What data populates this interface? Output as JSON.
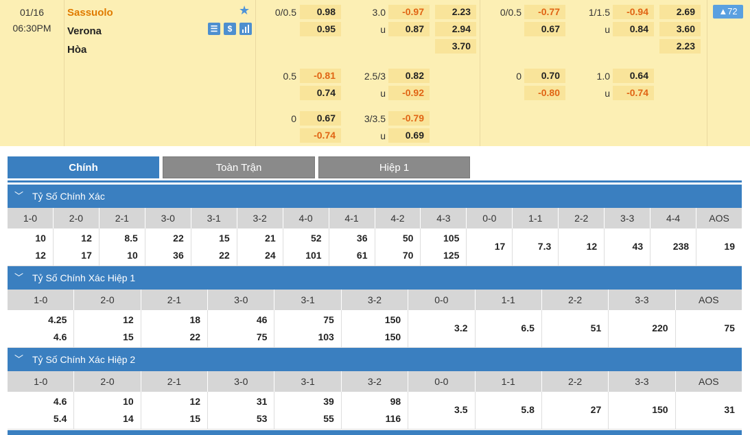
{
  "match": {
    "date": "01/16",
    "time": "06:30PM",
    "home": "Sassuolo",
    "away": "Verona",
    "draw": "Hòa",
    "icons": [
      "star-icon",
      "lineup-icon",
      "dollar-icon",
      "stats-icon"
    ],
    "more_count": "▲72",
    "ft_rows": [
      {
        "hcap": "0/0.5",
        "h1": "0.98",
        "h2": "0.95",
        "ou": "3.0",
        "o1": "-0.97",
        "u_label": "u",
        "o2": "0.87",
        "x1": "2.23",
        "x2": "2.94",
        "x3": "3.70"
      },
      {
        "hcap": "0.5",
        "h1": "-0.81",
        "h2": "0.74",
        "ou": "2.5/3",
        "o1": "0.82",
        "u_label": "u",
        "o2": "-0.92"
      },
      {
        "hcap": "0",
        "h1": "0.67",
        "h2": "-0.74",
        "ou": "3/3.5",
        "o1": "-0.79",
        "u_label": "u",
        "o2": "0.69"
      }
    ],
    "h1_rows": [
      {
        "hcap": "0/0.5",
        "h1": "-0.77",
        "h2": "0.67",
        "ou": "1/1.5",
        "o1": "-0.94",
        "u_label": "u",
        "o2": "0.84",
        "x1": "2.69",
        "x2": "3.60",
        "x3": "2.23"
      },
      {
        "hcap": "0",
        "h1": "0.70",
        "h2": "-0.80",
        "ou": "1.0",
        "o1": "0.64",
        "u_label": "u",
        "o2": "-0.74"
      }
    ]
  },
  "tabs": [
    "Chính",
    "Toàn Trận",
    "Hiệp 1"
  ],
  "sections": [
    {
      "title": "Tỷ Số Chính Xác",
      "headers": [
        "1-0",
        "2-0",
        "2-1",
        "3-0",
        "3-1",
        "3-2",
        "4-0",
        "4-1",
        "4-2",
        "4-3",
        "0-0",
        "1-1",
        "2-2",
        "3-3",
        "4-4",
        "AOS"
      ],
      "values": [
        [
          "10",
          "12"
        ],
        [
          "12",
          "17"
        ],
        [
          "8.5",
          "10"
        ],
        [
          "22",
          "36"
        ],
        [
          "15",
          "22"
        ],
        [
          "21",
          "24"
        ],
        [
          "52",
          "101"
        ],
        [
          "36",
          "61"
        ],
        [
          "50",
          "70"
        ],
        [
          "105",
          "125"
        ],
        [
          "17"
        ],
        [
          "7.3"
        ],
        [
          "12"
        ],
        [
          "43"
        ],
        [
          "238"
        ],
        [
          "19"
        ]
      ]
    },
    {
      "title": "Tỷ Số Chính Xác Hiệp 1",
      "headers": [
        "1-0",
        "2-0",
        "2-1",
        "3-0",
        "3-1",
        "3-2",
        "0-0",
        "1-1",
        "2-2",
        "3-3",
        "AOS"
      ],
      "values": [
        [
          "4.25",
          "4.6"
        ],
        [
          "12",
          "15"
        ],
        [
          "18",
          "22"
        ],
        [
          "46",
          "75"
        ],
        [
          "75",
          "103"
        ],
        [
          "150",
          "150"
        ],
        [
          "3.2"
        ],
        [
          "6.5"
        ],
        [
          "51"
        ],
        [
          "220"
        ],
        [
          "75"
        ]
      ]
    },
    {
      "title": "Tỷ Số Chính Xác Hiệp 2",
      "headers": [
        "1-0",
        "2-0",
        "2-1",
        "3-0",
        "3-1",
        "3-2",
        "0-0",
        "1-1",
        "2-2",
        "3-3",
        "AOS"
      ],
      "values": [
        [
          "4.6",
          "5.4"
        ],
        [
          "10",
          "14"
        ],
        [
          "12",
          "15"
        ],
        [
          "31",
          "53"
        ],
        [
          "39",
          "55"
        ],
        [
          "98",
          "116"
        ],
        [
          "3.5"
        ],
        [
          "5.8"
        ],
        [
          "27"
        ],
        [
          "150"
        ],
        [
          "31"
        ]
      ]
    }
  ],
  "colors": {
    "accent": "#3a7fc0",
    "header_bg": "#fcefb4",
    "negative": "#e06414",
    "home": "#e07b00"
  }
}
